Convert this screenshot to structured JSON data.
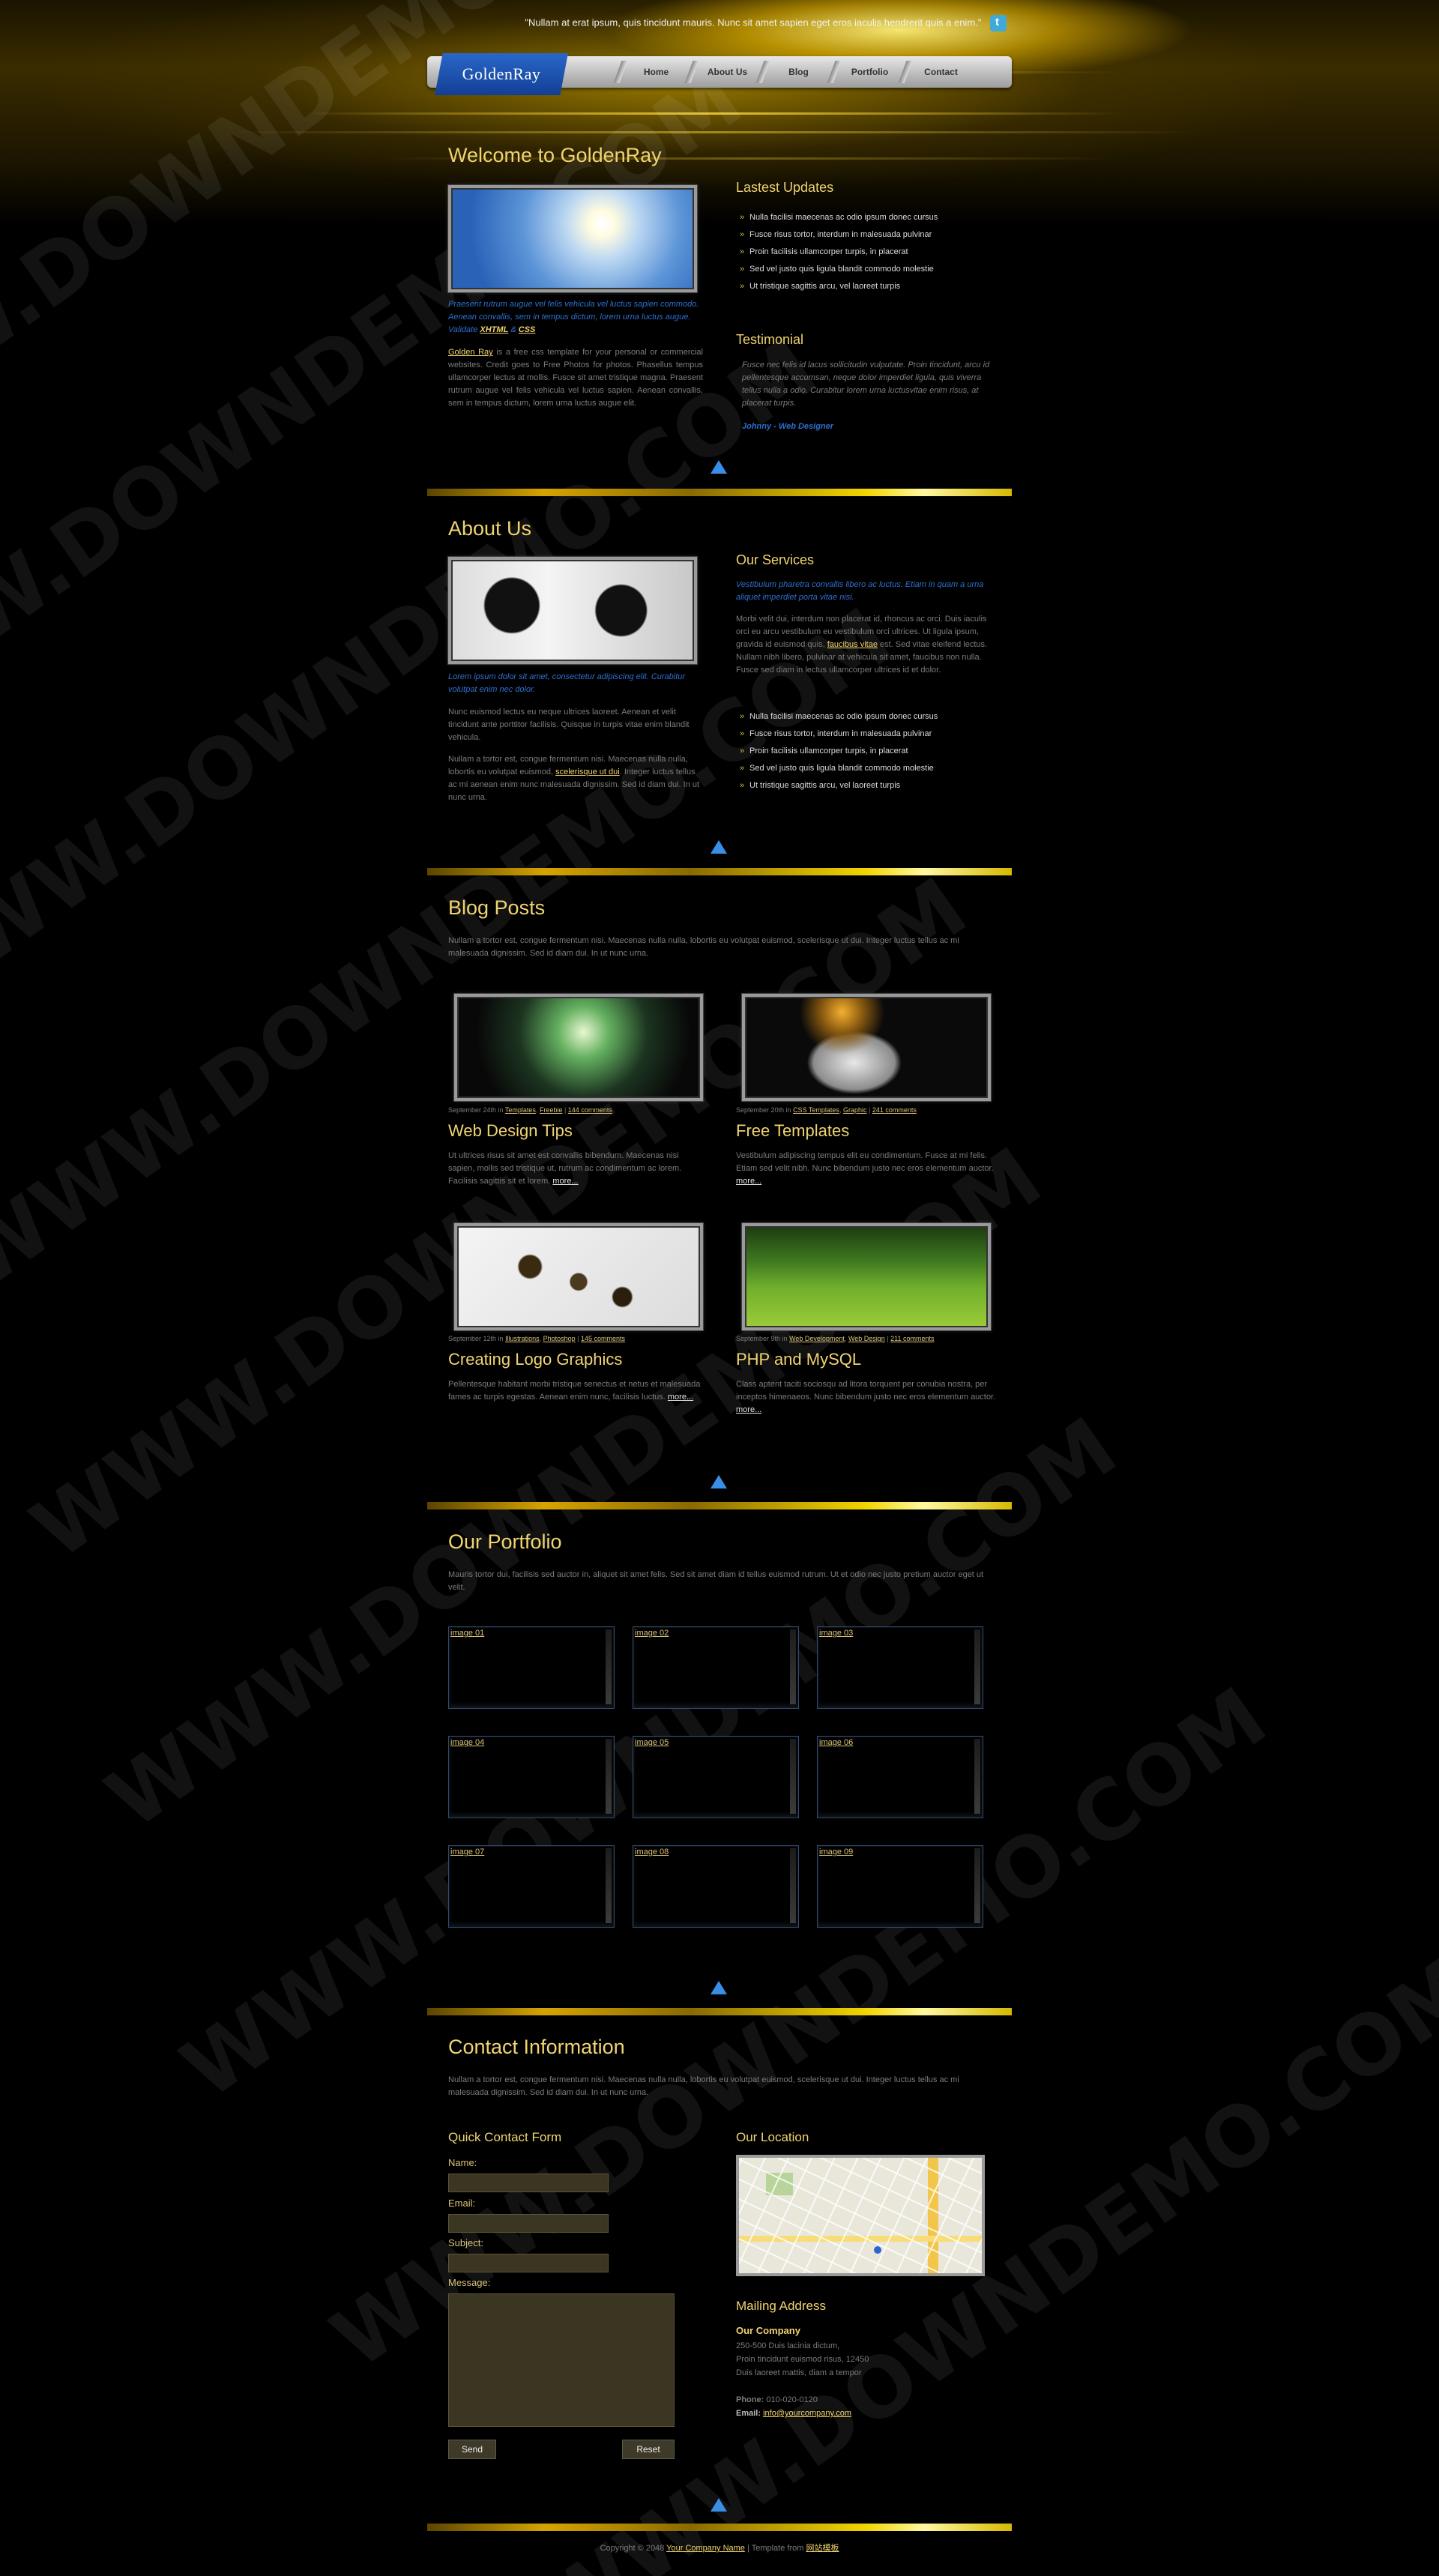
{
  "header": {
    "quote": "\"Nullam at erat ipsum, quis tincidunt mauris. Nunc sit amet sapien eget eros iaculis hendrerit quis a enim.\"",
    "logo_text": "GoldenRay",
    "nav": [
      {
        "label": "Home"
      },
      {
        "label": "About Us"
      },
      {
        "label": "Blog"
      },
      {
        "label": "Portfolio"
      },
      {
        "label": "Contact"
      }
    ]
  },
  "watermark": "WWW.DOWNDEMO.COM",
  "welcome": {
    "title": "Welcome to GoldenRay",
    "caption_text": "Praesent rutrum augue vel felis vehicula vel luctus sapien commodo. Aenean convallis, sem in tempus dictum, lorem urna luctus augue. Validate",
    "caption_link1": "XHTML",
    "caption_amp": "&",
    "caption_link2": "CSS",
    "body_link": "Golden Ray",
    "body_text": "is a free css template for your personal or commercial websites. Credit goes to Free Photos for photos. Phasellus tempus ullamcorper lectus at mollis. Fusce sit amet tristique magna. Praesent rutrum augue vel felis vehicula vel luctus sapien. Aenean convallis, sem in tempus dictum, lorem urna luctus augue elit.",
    "latest_title": "Lastest Updates",
    "latest_items": [
      "Nulla facilisi maecenas ac odio ipsum donec cursus",
      "Fusce risus tortor, interdum in malesuada pulvinar",
      "Proin facilisis ullamcorper turpis, in placerat",
      "Sed vel justo quis ligula blandit commodo molestie",
      "Ut tristique sagittis arcu, vel laoreet turpis"
    ],
    "testimonial_title": "Testimonial",
    "testimonial_text": "Fusce nec felis id lacus sollicitudin vulputate. Proin tincidunt, arcu id pellentesque accumsan, neque dolor imperdiet ligula, quis viverra tellus nulla a odio. Curabitur lorem urna luctusvitae enim risus, at placerat turpis.",
    "testimonial_author": "Johnny - Web Designer"
  },
  "about": {
    "title": "About Us",
    "caption": "Lorem ipsum dolor sit amet, consectetur adipiscing elit. Curabitur volutpat enim nec dolor.",
    "p1": "Nunc euismod lectus eu neque ultrices laoreet. Aenean et velit tincidunt ante porttitor facilisis. Quisque in turpis vitae enim blandit vehicula.",
    "p2a": "Nullam a tortor est, congue fermentum nisi. Maecenas nulla nulla, lobortis eu volutpat euismod,",
    "p2_link": "scelerisque ut dui",
    "p2b": ". Integer luctus tellus ac mi aenean enim nunc malesuada dignissim. Sed id diam dui. In ut nunc urna.",
    "services_title": "Our Services",
    "services_caption": "Vestibulum pharetra convallis libero ac luctus. Etiam in quam a urna aliquet imperdiet porta vitae nisi.",
    "services_text_a": "Morbi velit dui, interdum non placerat id, rhoncus ac orci. Duis iaculis orci eu arcu vestibulum eu vestibulum orci ultrices. Ut ligula ipsum, gravida id euismod quis,",
    "services_link": "faucibus vitae",
    "services_text_b": "est. Sed vitae eleifend lectus. Nullam nibh libero, pulvinar at vehicula sit amet, faucibus non nulla. Fusce sed diam in lectus ullamcorper ultrices id et dolor.",
    "services_items": [
      "Nulla facilisi maecenas ac odio ipsum donec cursus",
      "Fusce risus tortor, interdum in malesuada pulvinar",
      "Proin facilisis ullamcorper turpis, in placerat",
      "Sed vel justo quis ligula blandit commodo molestie",
      "Ut tristique sagittis arcu, vel laoreet turpis"
    ]
  },
  "blog": {
    "title": "Blog Posts",
    "intro": "Nullam a tortor est, congue fermentum nisi. Maecenas nulla nulla, lobortis eu volutpat euismod, scelerisque ut dui. Integer luctus tellus ac mi malesuada dignissim. Sed id diam dui. In ut nunc urna.",
    "posts": [
      {
        "date": "September 24th in",
        "cat1": "Templates",
        "cat2": "Freebie",
        "comments": "144 comments",
        "title": "Web Design Tips",
        "excerpt": "Ut ultrices risus sit amet est convallis bibendum. Maecenas nisi sapien, mollis sed tristique ut, rutrum ac condimentum ac lorem. Facilisis sagittis sit et lorem.",
        "more": "more..."
      },
      {
        "date": "September 20th in",
        "cat1": "CSS Templates",
        "cat2": "Graphic",
        "comments": "241 comments",
        "title": "Free Templates",
        "excerpt": "Vestibulum adipiscing tempus elit eu condimentum. Fusce at mi felis. Etiam sed velit nibh. Nunc bibendum justo nec eros elementum auctor.",
        "more": "more..."
      },
      {
        "date": "September 12th in",
        "cat1": "Illustrations",
        "cat2": "Photoshop",
        "comments": "145 comments",
        "title": "Creating Logo Graphics",
        "excerpt": "Pellentesque habitant morbi tristique senectus et netus et malesuada fames ac turpis egestas. Aenean enim nunc, facilisis luctus.",
        "more": "more..."
      },
      {
        "date": "September 9th in",
        "cat1": "Web Development",
        "cat2": "Web Design",
        "comments": "211 comments",
        "title": "PHP and MySQL",
        "excerpt": "Class aptent taciti sociosqu ad litora torquent per conubia nostra, per inceptos himenaeos. Nunc bibendum justo nec eros elementum auctor.",
        "more": "more..."
      }
    ]
  },
  "portfolio": {
    "title": "Our Portfolio",
    "intro": "Mauris tortor dui, facilisis sed auctor in, aliquet sit amet felis. Sed sit amet diam id tellus euismod rutrum. Ut et odio nec justo pretium auctor eget ut velit.",
    "images": [
      "image 01",
      "image 02",
      "image 03",
      "image 04",
      "image 05",
      "image 06",
      "image 07",
      "image 08",
      "image 09"
    ]
  },
  "contact": {
    "title": "Contact Information",
    "intro": "Nullam a tortor est, congue fermentum nisi. Maecenas nulla nulla, lobortis eu volutpat euismod, scelerisque ut dui. Integer luctus tellus ac mi malesuada dignissim. Sed id diam dui. In ut nunc urna.",
    "form_title": "Quick Contact Form",
    "name_label": "Name:",
    "email_label": "Email:",
    "subject_label": "Subject:",
    "message_label": "Message:",
    "send_label": "Send",
    "reset_label": "Reset",
    "location_title": "Our Location",
    "mailing_title": "Mailing Address",
    "company": "Our Company",
    "address1": "250-500 Duis lacinia dictum,",
    "address2": "Proin tincidunt euismod risus, 12450",
    "address3": "Duis laoreet mattis, diam a tempor",
    "phone_label": "Phone:",
    "phone": "010-020-0120",
    "email_label2": "Email:",
    "email": "info@yourcompany.com"
  },
  "footer": {
    "copyright": "Copyright © 2048",
    "company_link": "Your Company Name",
    "separator": "| Template from",
    "template_link": "网站模板"
  }
}
